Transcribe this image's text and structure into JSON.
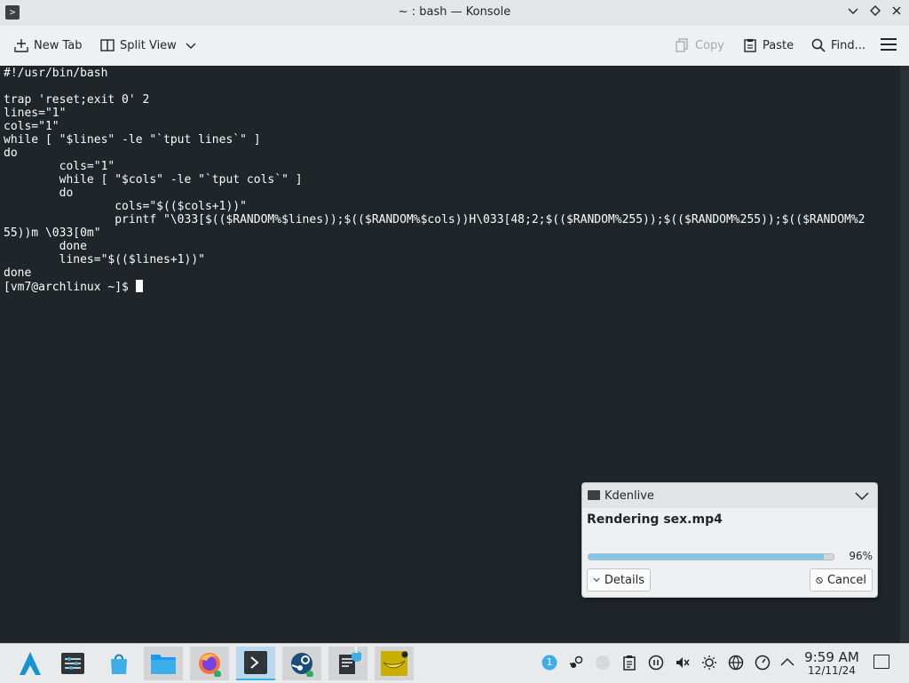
{
  "window": {
    "title": "~ : bash — Konsole",
    "controls": [
      "minimize-icon",
      "maximize-icon",
      "close-icon"
    ]
  },
  "toolbar": {
    "new_tab": "New Tab",
    "split_view": "Split View",
    "copy": "Copy",
    "paste": "Paste",
    "find": "Find..."
  },
  "terminal": {
    "lines": [
      "#!/usr/bin/bash",
      "",
      "trap 'reset;exit 0' 2",
      "lines=\"1\"",
      "cols=\"1\"",
      "while [ \"$lines\" -le \"`tput lines`\" ]",
      "do",
      "        cols=\"1\"",
      "        while [ \"$cols\" -le \"`tput cols`\" ]",
      "        do",
      "                cols=\"$(($cols+1))\"",
      "                printf \"\\033[$(($RANDOM%$lines));$(($RANDOM%$cols))H\\033[48;2;$(($RANDOM%255));$(($RANDOM%255));$(($RANDOM%2",
      "55))m \\033[0m\"",
      "        done",
      "        lines=\"$(($lines+1))\"",
      "done"
    ],
    "prompt": "[vm7@archlinux ~]$ "
  },
  "notification": {
    "app": "Kdenlive",
    "title": "Rendering sex.mp4",
    "progress_percent": 96,
    "progress_label": "96%",
    "details_label": "Details",
    "cancel_label": "Cancel"
  },
  "taskbar": {
    "apps": [
      "arch-launcher-icon",
      "system-settings-icon",
      "discover-icon",
      "dolphin-icon",
      "firefox-icon",
      "konsole-icon",
      "steam-icon",
      "kdenlive-icon",
      "banana-icon"
    ],
    "tray_badge": "1",
    "kdenlive_badge": "1",
    "clock_time": "9:59 AM",
    "clock_date": "12/11/24"
  },
  "colors": {
    "accent": "#3daee9",
    "terminal_bg": "#1f2528",
    "progress": "#7fc8ec"
  }
}
